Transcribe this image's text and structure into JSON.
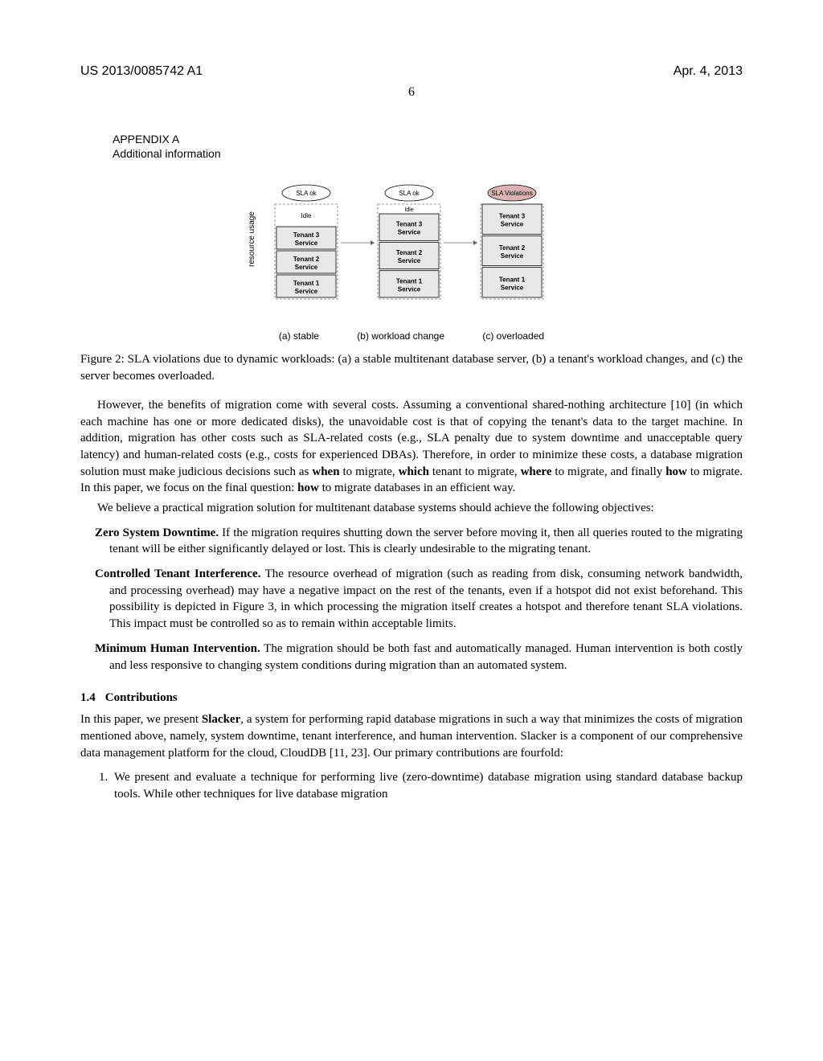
{
  "header": {
    "pub_number": "US 2013/0085742 A1",
    "date": "Apr. 4, 2013",
    "page": "6"
  },
  "appendix": {
    "title": "APPENDIX A",
    "subtitle": "Additional information"
  },
  "figure": {
    "axis_label": "resource usage",
    "cols": [
      {
        "sla": "SLA ok",
        "idle": "Idle",
        "boxes": [
          "Tenant 3 Service",
          "Tenant 2 Service",
          "Tenant 1 Service"
        ],
        "sub": "(a) stable",
        "violation": false
      },
      {
        "sla": "SLA ok",
        "idle": "Idle",
        "boxes": [
          "Tenant 3 Service",
          "Tenant 2 Service",
          "Tenant 1 Service"
        ],
        "sub": "(b) workload change",
        "violation": false
      },
      {
        "sla": "SLA Violations",
        "idle": "",
        "boxes": [
          "Tenant 3 Service",
          "Tenant 2 Service",
          "Tenant 1 Service"
        ],
        "sub": "(c) overloaded",
        "violation": true
      }
    ]
  },
  "caption": {
    "label": "Figure 2:",
    "text": " SLA violations due to dynamic workloads: (a) a stable multitenant database server, (b) a tenant's workload changes, and (c) the server becomes overloaded."
  },
  "body": {
    "p1_pre": "However, the benefits of migration come with several costs. Assuming a conventional shared-nothing architecture [10] (in which each machine has one or more dedicated disks), the unavoidable cost is that of copying the tenant's data to the target machine. In addition, migration has other costs such as SLA-related costs (e.g., SLA penalty due to system downtime and unacceptable query latency) and human-related costs (e.g., costs for experienced DBAs). Therefore, in order to minimize these costs, a database migration solution must make judicious decisions such as ",
    "w_when": "when",
    "p1_mid1": " to migrate, ",
    "w_which": "which",
    "p1_mid2": " tenant to migrate, ",
    "w_where": "where",
    "p1_mid3": " to migrate, and finally ",
    "w_how": "how",
    "p1_mid4": " to migrate. In this paper, we focus on the final question: ",
    "w_how2": "how",
    "p1_end": " to migrate databases in an efficient way.",
    "p2": "We believe a practical migration solution for multitenant database systems should achieve the following objectives:"
  },
  "objectives": [
    {
      "title": "Zero System Downtime.",
      "text": " If the migration requires shutting down the server before moving it, then all queries routed to the migrating tenant will be either significantly delayed or lost. This is clearly undesirable to the migrating tenant."
    },
    {
      "title": "Controlled Tenant Interference.",
      "text": " The resource overhead of migration (such as reading from disk, consuming network bandwidth, and processing overhead) may have a negative impact on the rest of the tenants, even if a hotspot did not exist beforehand. This possibility is depicted in Figure 3, in which processing the migration itself creates a hotspot and therefore tenant SLA violations. This impact must be controlled so as to remain within acceptable limits."
    },
    {
      "title": "Minimum Human Intervention.",
      "text": " The migration should be both fast and automatically managed. Human intervention is both costly and less responsive to changing system conditions during migration than an automated system."
    }
  ],
  "section": {
    "num": "1.4",
    "title": "Contributions"
  },
  "contrib_intro_pre": "In this paper, we present ",
  "contrib_intro_bold": "Slacker",
  "contrib_intro_post": ", a system for performing rapid database migrations in such a way that minimizes the costs of migration mentioned above, namely, system downtime, tenant interference, and human intervention. Slacker is a component of our comprehensive data management platform for the cloud, CloudDB [11, 23]. Our primary contributions are fourfold:",
  "contrib_item1": "We present and evaluate a technique for performing live (zero-downtime) database migration using standard database backup tools. While other techniques for live database migration"
}
